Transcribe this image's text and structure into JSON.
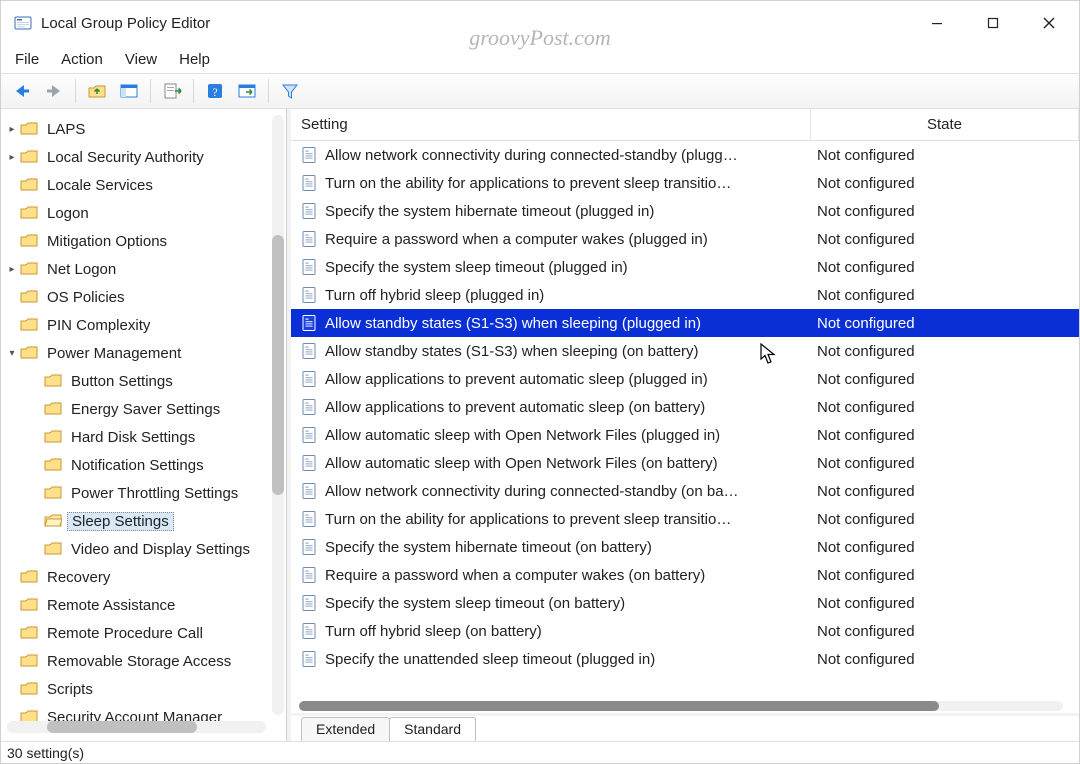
{
  "window": {
    "title": "Local Group Policy Editor",
    "watermark": "groovyPost.com"
  },
  "menubar": {
    "file": "File",
    "action": "Action",
    "view": "View",
    "help": "Help"
  },
  "tabs": {
    "extended": "Extended",
    "standard": "Standard"
  },
  "statusbar": {
    "text": "30 setting(s)"
  },
  "columns": {
    "setting": "Setting",
    "state": "State"
  },
  "tree": {
    "items": [
      {
        "label": "LAPS",
        "indent": 0,
        "expandable": true,
        "sel": false
      },
      {
        "label": "Local Security Authority",
        "indent": 0,
        "expandable": true,
        "sel": false
      },
      {
        "label": "Locale Services",
        "indent": 0,
        "expandable": false,
        "sel": false
      },
      {
        "label": "Logon",
        "indent": 0,
        "expandable": false,
        "sel": false
      },
      {
        "label": "Mitigation Options",
        "indent": 0,
        "expandable": false,
        "sel": false
      },
      {
        "label": "Net Logon",
        "indent": 0,
        "expandable": true,
        "sel": false
      },
      {
        "label": "OS Policies",
        "indent": 0,
        "expandable": false,
        "sel": false
      },
      {
        "label": "PIN Complexity",
        "indent": 0,
        "expandable": false,
        "sel": false
      },
      {
        "label": "Power Management",
        "indent": 0,
        "expandable": true,
        "expanded": true,
        "sel": false
      },
      {
        "label": "Button Settings",
        "indent": 1,
        "sel": false
      },
      {
        "label": "Energy Saver Settings",
        "indent": 1,
        "sel": false
      },
      {
        "label": "Hard Disk Settings",
        "indent": 1,
        "sel": false
      },
      {
        "label": "Notification Settings",
        "indent": 1,
        "sel": false
      },
      {
        "label": "Power Throttling Settings",
        "indent": 1,
        "sel": false
      },
      {
        "label": "Sleep Settings",
        "indent": 1,
        "sel": true
      },
      {
        "label": "Video and Display Settings",
        "indent": 1,
        "sel": false
      },
      {
        "label": "Recovery",
        "indent": 0,
        "expandable": false,
        "sel": false
      },
      {
        "label": "Remote Assistance",
        "indent": 0,
        "expandable": false,
        "sel": false
      },
      {
        "label": "Remote Procedure Call",
        "indent": 0,
        "expandable": false,
        "sel": false
      },
      {
        "label": "Removable Storage Access",
        "indent": 0,
        "expandable": false,
        "sel": false
      },
      {
        "label": "Scripts",
        "indent": 0,
        "expandable": false,
        "sel": false
      },
      {
        "label": "Security Account Manager",
        "indent": 0,
        "expandable": false,
        "sel": false
      }
    ]
  },
  "settings": {
    "rows": [
      {
        "label": "Allow network connectivity during connected-standby (plugg…",
        "state": "Not configured",
        "sel": false
      },
      {
        "label": "Turn on the ability for applications to prevent sleep transitio…",
        "state": "Not configured",
        "sel": false
      },
      {
        "label": "Specify the system hibernate timeout (plugged in)",
        "state": "Not configured",
        "sel": false
      },
      {
        "label": "Require a password when a computer wakes (plugged in)",
        "state": "Not configured",
        "sel": false
      },
      {
        "label": "Specify the system sleep timeout (plugged in)",
        "state": "Not configured",
        "sel": false
      },
      {
        "label": "Turn off hybrid sleep (plugged in)",
        "state": "Not configured",
        "sel": false
      },
      {
        "label": "Allow standby states (S1-S3) when sleeping (plugged in)",
        "state": "Not configured",
        "sel": true
      },
      {
        "label": "Allow standby states (S1-S3) when sleeping (on battery)",
        "state": "Not configured",
        "sel": false
      },
      {
        "label": "Allow applications to prevent automatic sleep (plugged in)",
        "state": "Not configured",
        "sel": false
      },
      {
        "label": "Allow applications to prevent automatic sleep (on battery)",
        "state": "Not configured",
        "sel": false
      },
      {
        "label": "Allow automatic sleep with Open Network Files (plugged in)",
        "state": "Not configured",
        "sel": false
      },
      {
        "label": "Allow automatic sleep with Open Network Files (on battery)",
        "state": "Not configured",
        "sel": false
      },
      {
        "label": "Allow network connectivity during connected-standby (on ba…",
        "state": "Not configured",
        "sel": false
      },
      {
        "label": "Turn on the ability for applications to prevent sleep transitio…",
        "state": "Not configured",
        "sel": false
      },
      {
        "label": "Specify the system hibernate timeout (on battery)",
        "state": "Not configured",
        "sel": false
      },
      {
        "label": "Require a password when a computer wakes (on battery)",
        "state": "Not configured",
        "sel": false
      },
      {
        "label": "Specify the system sleep timeout (on battery)",
        "state": "Not configured",
        "sel": false
      },
      {
        "label": "Turn off hybrid sleep (on battery)",
        "state": "Not configured",
        "sel": false
      },
      {
        "label": "Specify the unattended sleep timeout (plugged in)",
        "state": "Not configured",
        "sel": false
      }
    ]
  }
}
